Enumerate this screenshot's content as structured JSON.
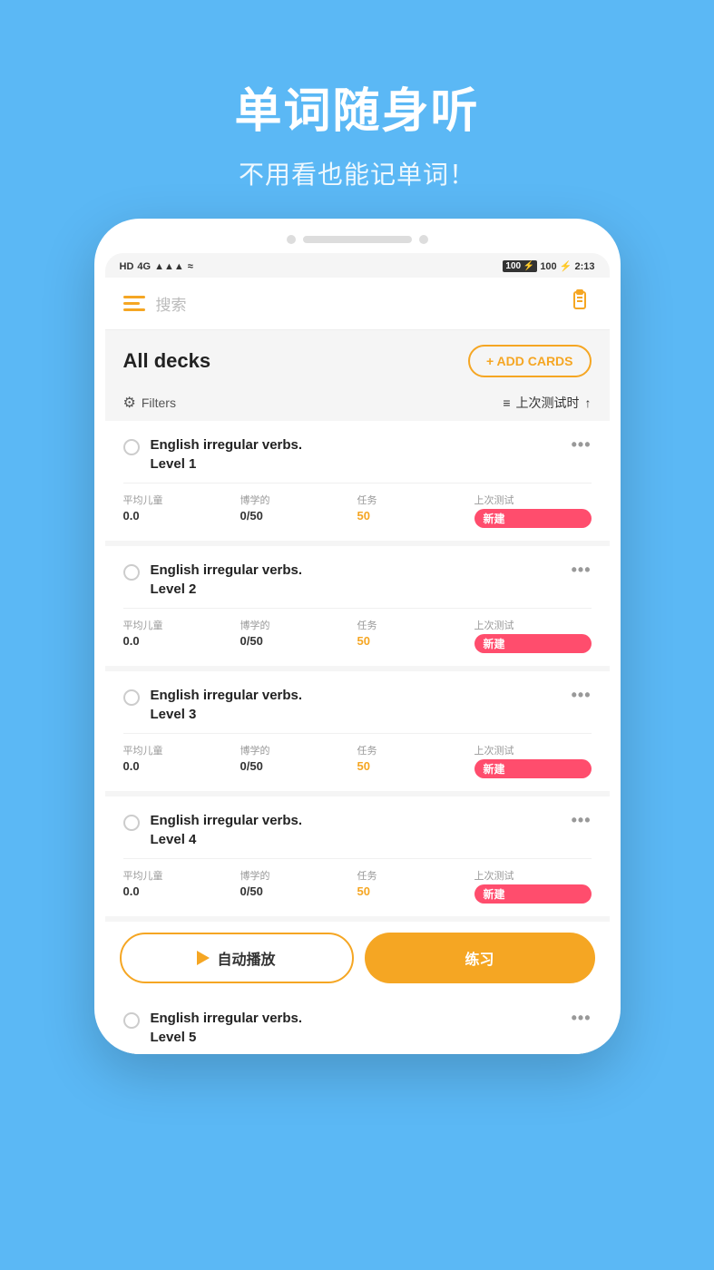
{
  "hero": {
    "title": "单词随身听",
    "subtitle": "不用看也能记单词！"
  },
  "status_bar": {
    "left": "HD 4G  .ill  ≈",
    "right": "100 ⚡ 2:13"
  },
  "nav": {
    "search_placeholder": "搜索"
  },
  "decks_section": {
    "title": "All decks",
    "add_cards_label": "+ ADD CARDS",
    "filters_label": "Filters",
    "sort_label": "上次测试时"
  },
  "decks": [
    {
      "name": "English irregular verbs.\nLevel 1",
      "stats": {
        "avg_label": "平均儿童",
        "avg_value": "0.0",
        "learned_label": "博学的",
        "learned_value": "0/50",
        "task_label": "任务",
        "task_value": "50",
        "last_test_label": "上次测试",
        "last_test_value": "新建"
      }
    },
    {
      "name": "English irregular verbs.\nLevel 2",
      "stats": {
        "avg_label": "平均儿童",
        "avg_value": "0.0",
        "learned_label": "博学的",
        "learned_value": "0/50",
        "task_label": "任务",
        "task_value": "50",
        "last_test_label": "上次测试",
        "last_test_value": "新建"
      }
    },
    {
      "name": "English irregular verbs.\nLevel 3",
      "stats": {
        "avg_label": "平均儿童",
        "avg_value": "0.0",
        "learned_label": "博学的",
        "learned_value": "0/50",
        "task_label": "任务",
        "task_value": "50",
        "last_test_label": "上次测试",
        "last_test_value": "新建"
      }
    },
    {
      "name": "English irregular verbs.\nLevel 4",
      "stats": {
        "avg_label": "平均儿童",
        "avg_value": "0.0",
        "learned_label": "博学的",
        "learned_value": "0/50",
        "task_label": "任务",
        "task_value": "50",
        "last_test_label": "上次测试",
        "last_test_value": "新建"
      }
    }
  ],
  "partial_deck": {
    "name": "English irregular verbs.\nLevel 5"
  },
  "bottom_bar": {
    "auto_play_label": "自动播放",
    "practice_label": "练习"
  }
}
